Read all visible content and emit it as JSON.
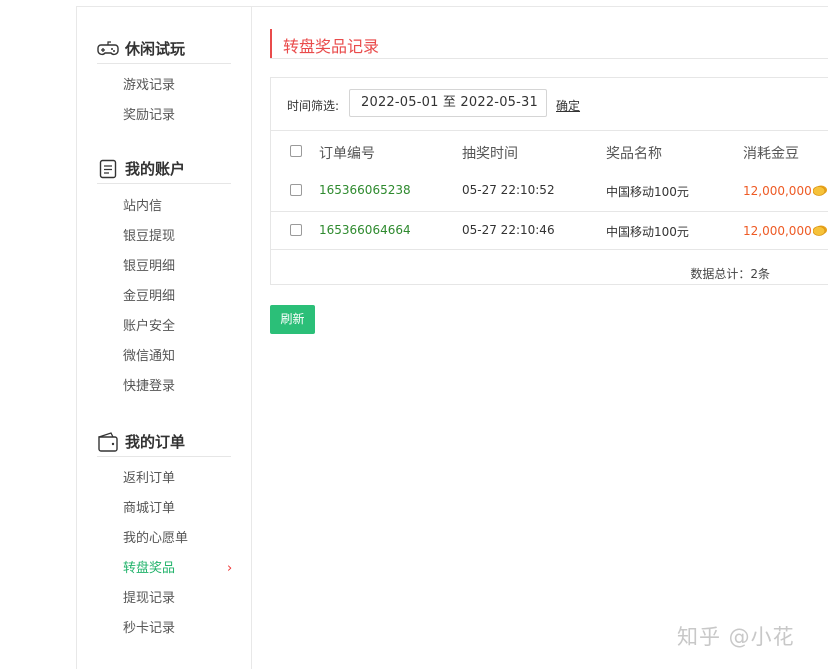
{
  "sidebar": {
    "sections": [
      {
        "icon": "gamepad-icon",
        "title": "休闲试玩",
        "items": [
          {
            "label": "游戏记录"
          },
          {
            "label": "奖励记录"
          }
        ]
      },
      {
        "icon": "document-icon",
        "title": "我的账户",
        "items": [
          {
            "label": "站内信"
          },
          {
            "label": "银豆提现"
          },
          {
            "label": "银豆明细"
          },
          {
            "label": "金豆明细"
          },
          {
            "label": "账户安全"
          },
          {
            "label": "微信通知"
          },
          {
            "label": "快捷登录"
          }
        ]
      },
      {
        "icon": "wallet-icon",
        "title": "我的订单",
        "items": [
          {
            "label": "返利订单"
          },
          {
            "label": "商城订单"
          },
          {
            "label": "我的心愿单"
          },
          {
            "label": "转盘奖品",
            "active": true,
            "chevron": "›"
          },
          {
            "label": "提现记录"
          },
          {
            "label": "秒卡记录"
          }
        ]
      }
    ],
    "active_color": "#22b36b"
  },
  "main": {
    "title": "转盘奖品记录",
    "title_color": "#e94b4b",
    "filter": {
      "label": "时间筛选:",
      "range": "2022-05-01 至 2022-05-31",
      "confirm": "确定"
    },
    "table": {
      "headers": [
        "订单编号",
        "抽奖时间",
        "奖品名称",
        "消耗金豆"
      ],
      "rows": [
        {
          "order_id": "165366065238",
          "time": "05-27 22:10:52",
          "prize": "中国移动100元",
          "coins": "12,000,000"
        },
        {
          "order_id": "165366064664",
          "time": "05-27 22:10:46",
          "prize": "中国移动100元",
          "coins": "12,000,000"
        }
      ],
      "total": "数据总计：2条"
    },
    "refresh": "刷新",
    "refresh_color": "#2bbf78"
  },
  "watermark": "知乎 @小花"
}
